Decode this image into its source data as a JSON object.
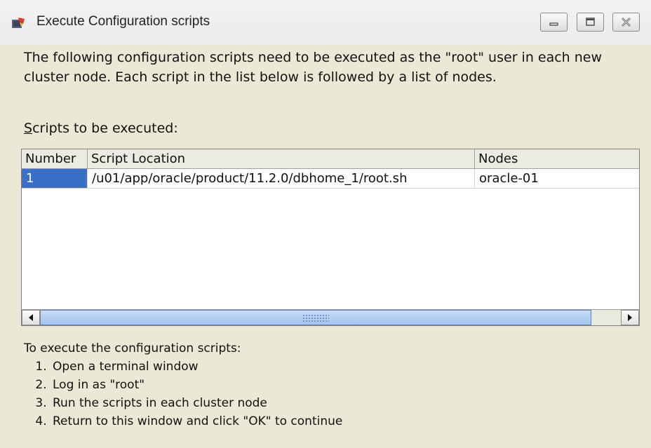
{
  "window": {
    "title": "Execute Configuration scripts",
    "title_icon": "oracle-installer-icon",
    "controls": [
      "minimize-icon",
      "maximize-icon",
      "close-icon"
    ]
  },
  "intro_text": "The following configuration scripts need to be executed as the \"root\" user in each new cluster node. Each script in the list below is followed by a list of nodes.",
  "scripts_label": {
    "mnemonic": "S",
    "rest": "cripts to be executed:"
  },
  "table": {
    "columns": [
      "Number",
      "Script Location",
      "Nodes"
    ],
    "rows": [
      {
        "number": "1",
        "location": "/u01/app/oracle/product/11.2.0/dbhome_1/root.sh",
        "nodes": "oracle-01"
      }
    ]
  },
  "instructions": {
    "heading": "To execute the configuration scripts:",
    "steps": [
      "Open a terminal window",
      "Log in as \"root\"",
      "Run the scripts in each cluster node",
      "Return to this window and click \"OK\" to continue"
    ]
  },
  "colors": {
    "selection": "#3a6fc8",
    "background": "#ebe9d6",
    "scroll_thumb": "#a4c4ee"
  }
}
